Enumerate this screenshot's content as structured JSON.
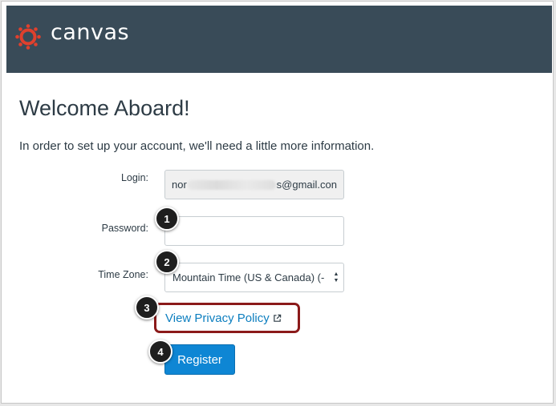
{
  "header": {
    "brand": "canvas",
    "logo_icon": "canvas-logo-icon",
    "bg_color": "#394b58"
  },
  "main": {
    "title": "Welcome Aboard!",
    "intro": "In order to set up your account, we'll need a little more information.",
    "login": {
      "label": "Login:",
      "value_start": "nor",
      "value_end": "s@gmail.con"
    },
    "password": {
      "label": "Password:",
      "value": ""
    },
    "timezone": {
      "label": "Time Zone:",
      "selected": "Mountain Time (US & Canada) (-"
    },
    "privacy_link": "View Privacy Policy",
    "register_label": "Register"
  },
  "callouts": [
    "1",
    "2",
    "3",
    "4"
  ],
  "colors": {
    "link": "#0c7ebf",
    "button": "#0e86d4",
    "highlight": "#8b1a1a"
  }
}
